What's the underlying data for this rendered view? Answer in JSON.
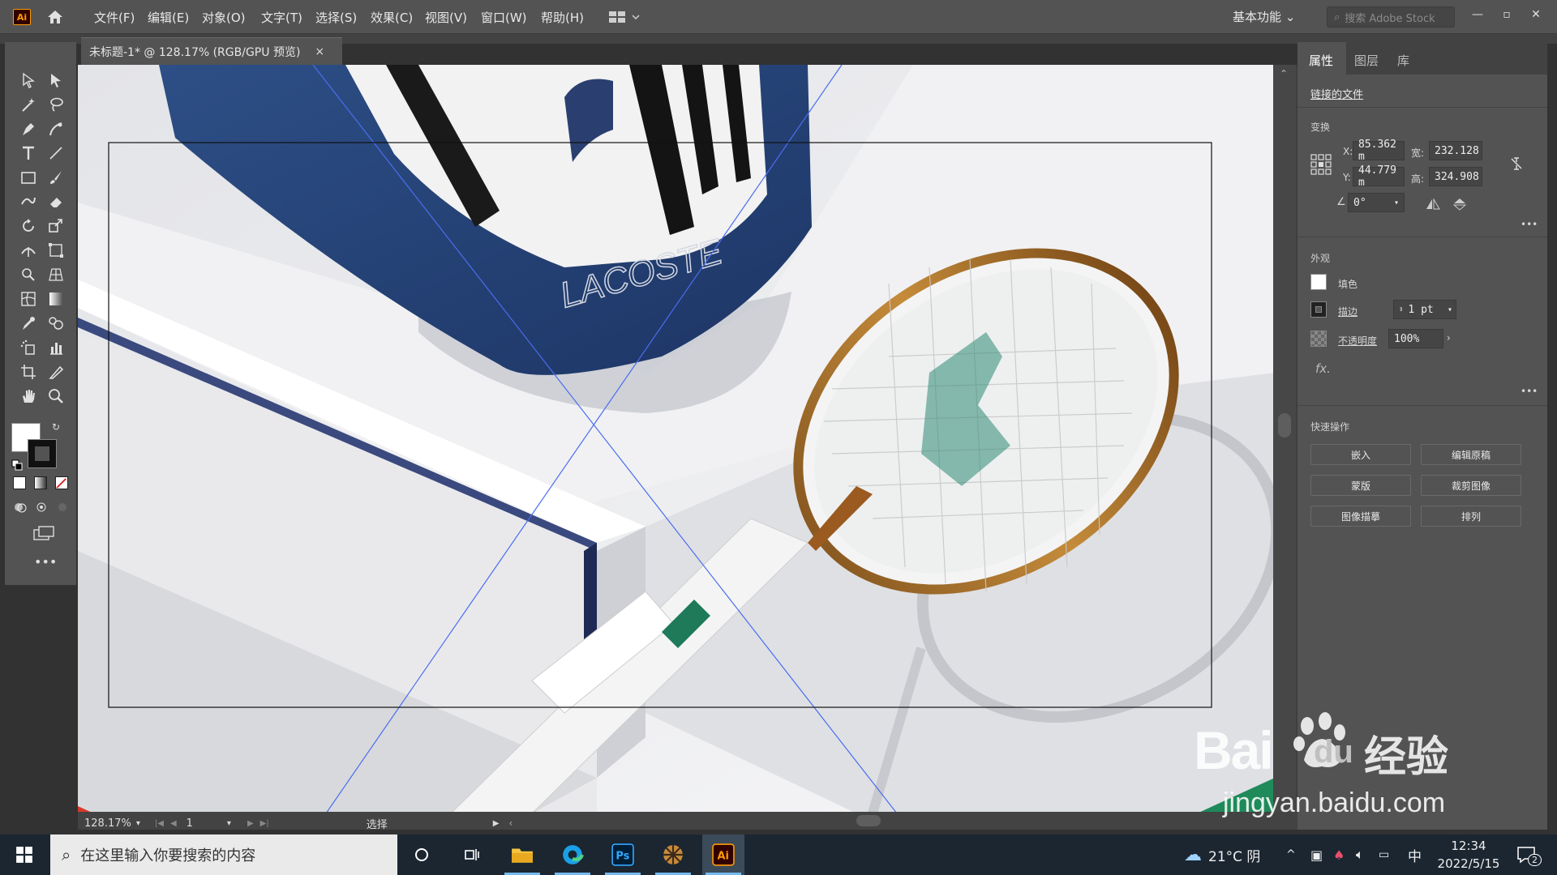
{
  "app": {
    "logo_text": "Ai",
    "menus": [
      "文件(F)",
      "编辑(E)",
      "对象(O)",
      "文字(T)",
      "选择(S)",
      "效果(C)",
      "视图(V)",
      "窗口(W)",
      "帮助(H)"
    ],
    "workspace_label": "基本功能",
    "stock_search_placeholder": "搜索 Adobe Stock"
  },
  "document": {
    "tab_title": "未标题-1* @ 128.17% (RGB/GPU 预览)",
    "close_glyph": "×"
  },
  "status": {
    "zoom": "128.17%",
    "artboard_number": "1",
    "tool_label": "选择"
  },
  "panel": {
    "tabs": [
      "属性",
      "图层",
      "库"
    ],
    "linked_file": "链接的文件",
    "transform": {
      "title": "变换",
      "x_label": "X:",
      "x_value": "85.362 m",
      "y_label": "Y:",
      "y_value": "44.779 m",
      "w_label": "宽:",
      "w_value": "232.128",
      "h_label": "高:",
      "h_value": "324.908",
      "angle_value": "0°"
    },
    "appearance": {
      "title": "外观",
      "fill_label": "填色",
      "stroke_label": "描边",
      "stroke_value": "1 pt",
      "opacity_label": "不透明度",
      "opacity_value": "100%",
      "fx_label": "fx."
    },
    "quick_actions": {
      "title": "快速操作",
      "buttons": [
        "嵌入",
        "编辑原稿",
        "蒙版",
        "裁剪图像",
        "图像描摹",
        "排列"
      ]
    }
  },
  "taskbar": {
    "search_placeholder": "在这里输入你要搜索的内容",
    "weather": "21°C 阴",
    "ime": "中",
    "time": "12:34",
    "date": "2022/5/15",
    "notification_count": "2"
  },
  "watermark": {
    "brand_top": "Bai",
    "brand_du": "du",
    "brand_cn": "经验",
    "url": "jingyan.baidu.com"
  },
  "artwork": {
    "bag_text": "LACOSTE"
  }
}
